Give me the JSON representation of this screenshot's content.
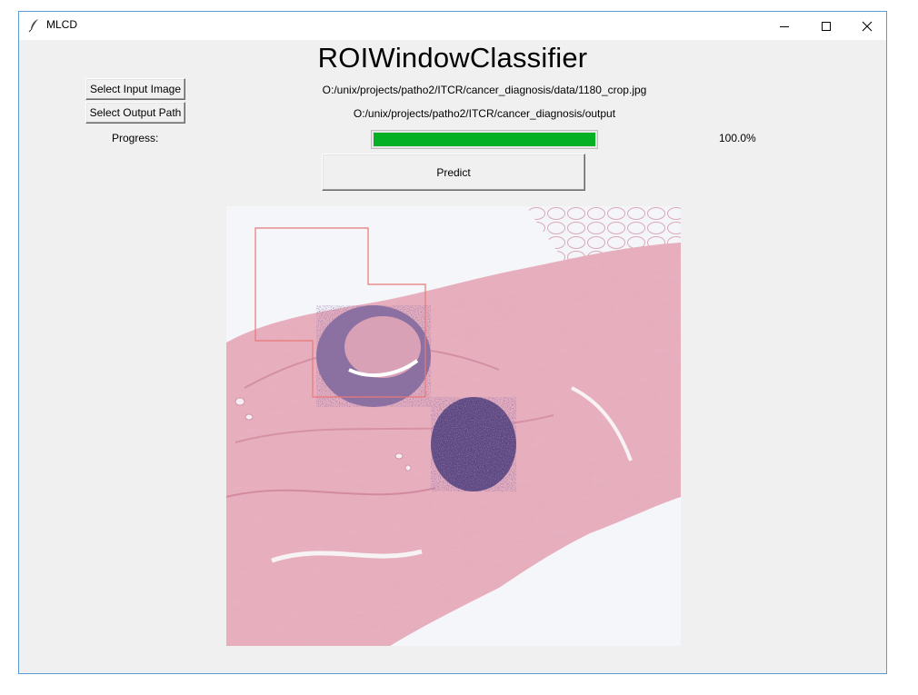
{
  "window": {
    "title": "MLCD",
    "controls": {
      "minimize": "minimize-icon",
      "maximize": "maximize-icon",
      "close": "close-icon"
    }
  },
  "header": {
    "title": "ROIWindowClassifier"
  },
  "inputs": {
    "select_input_label": "Select Input Image",
    "input_path": "O:/unix/projects/patho2/ITCR/cancer_diagnosis/data/1180_crop.jpg",
    "select_output_label": "Select Output Path",
    "output_path": "O:/unix/projects/patho2/ITCR/cancer_diagnosis/output"
  },
  "progress": {
    "label": "Progress:",
    "value_text": "100.0%",
    "fraction": 1.0,
    "fill_color": "#06b025"
  },
  "actions": {
    "predict_label": "Predict"
  },
  "image": {
    "content": "H&E stained histopathology tissue crop",
    "roi_box_color": "#e87878"
  }
}
